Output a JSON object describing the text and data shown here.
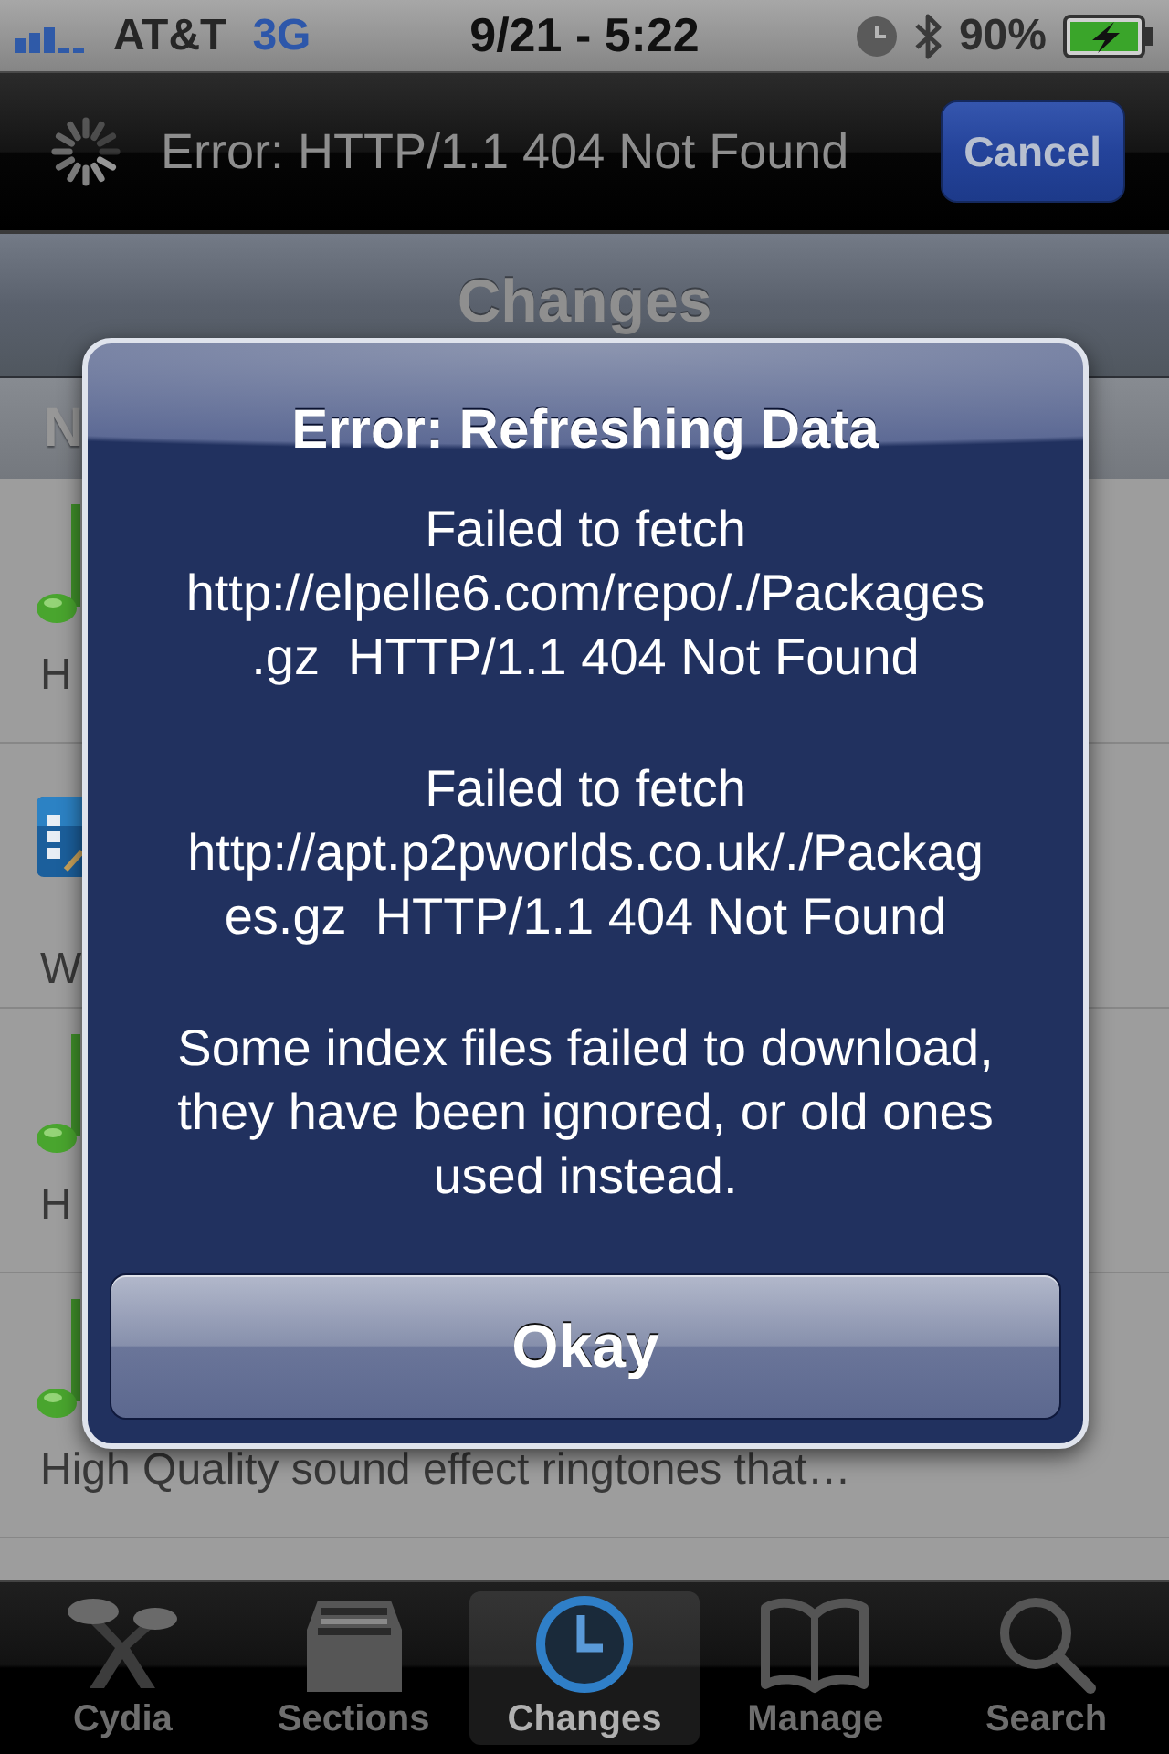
{
  "status_bar": {
    "carrier": "AT&T",
    "network": "3G",
    "time": "9/21 - 5:22",
    "battery": "90%"
  },
  "progress_bar": {
    "message": "Error: HTTP/1.1 404 Not Found",
    "button": "Cancel"
  },
  "nav_bar": {
    "title": "Changes"
  },
  "section_header": {
    "title": "N"
  },
  "packages": [
    {
      "kind": "note",
      "description": "H"
    },
    {
      "kind": "theme",
      "description": "W"
    },
    {
      "kind": "note",
      "description": "H"
    },
    {
      "kind": "note",
      "description": "High Quality sound effect ringtones that…"
    }
  ],
  "alert": {
    "title": "Error: Refreshing Data",
    "paragraphs": [
      "Failed to fetch\nhttp://elpelle6.com/repo/./Packages\n.gz  HTTP/1.1 404 Not Found",
      "Failed to fetch\nhttp://apt.p2pworlds.co.uk/./Packag\nes.gz  HTTP/1.1 404 Not Found",
      "Some index files failed to download,\nthey have been ignored, or old ones\nused instead."
    ],
    "button": "Okay"
  },
  "tab_bar": {
    "tabs": [
      {
        "label": "Cydia",
        "selected": false
      },
      {
        "label": "Sections",
        "selected": false
      },
      {
        "label": "Changes",
        "selected": true
      },
      {
        "label": "Manage",
        "selected": false
      },
      {
        "label": "Search",
        "selected": false
      }
    ]
  }
}
